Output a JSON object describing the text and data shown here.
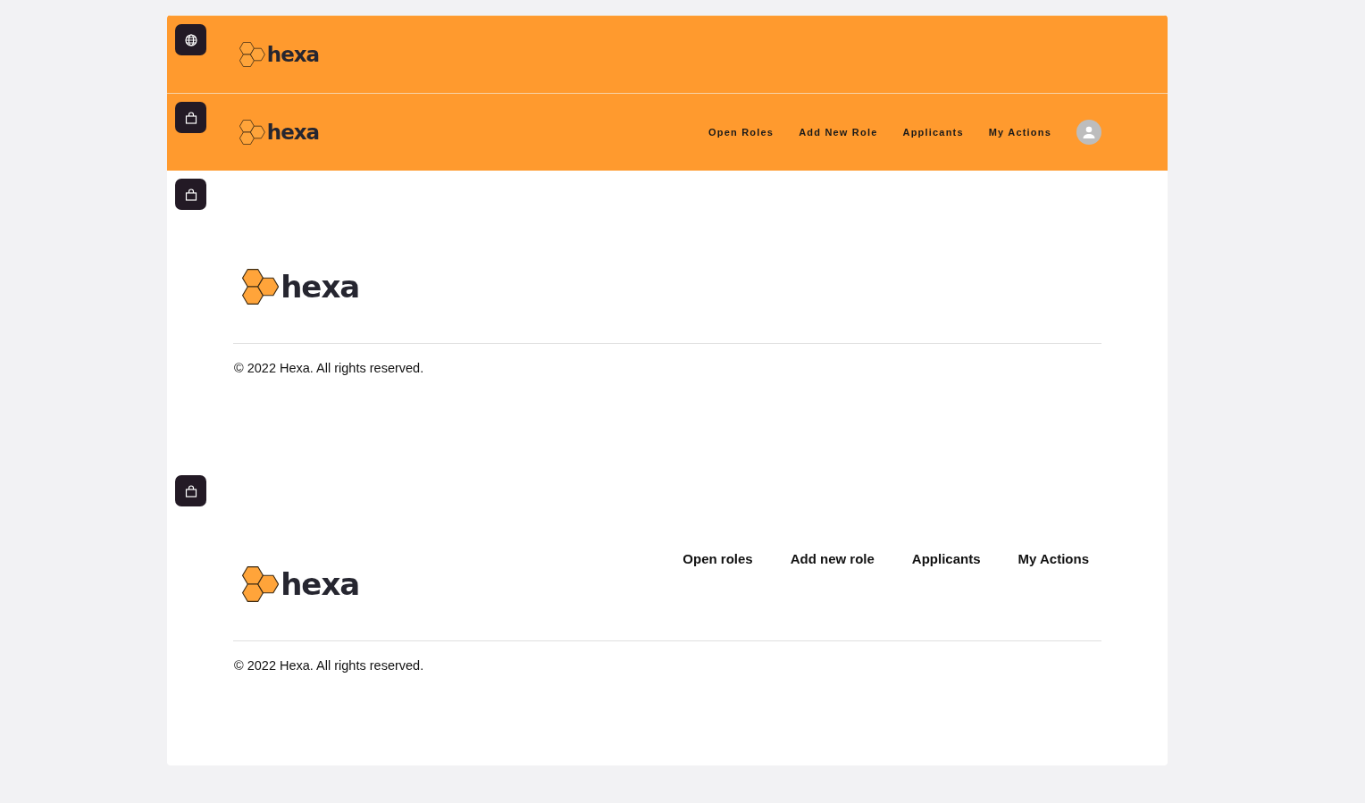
{
  "sections": [
    {
      "kind": "header",
      "badge": {
        "kind": "globe"
      },
      "logo": "hexa"
    },
    {
      "kind": "header",
      "badge": {
        "kind": "bag"
      },
      "logo": "hexa",
      "nav": [
        "Open Roles",
        "Add New Role",
        "Applicants",
        "My Actions"
      ]
    },
    {
      "kind": "footer",
      "badge": {
        "kind": "bag"
      },
      "logo": "hexa",
      "copyright": "© 2022 Hexa. All rights reserved."
    },
    {
      "kind": "footer",
      "badge": {
        "kind": "bag"
      },
      "logo": "hexa",
      "nav": [
        "Open roles",
        "Add new role",
        "Applicants",
        "My Actions"
      ],
      "copyright": "© 2022 Hexa. All rights reserved."
    }
  ]
}
